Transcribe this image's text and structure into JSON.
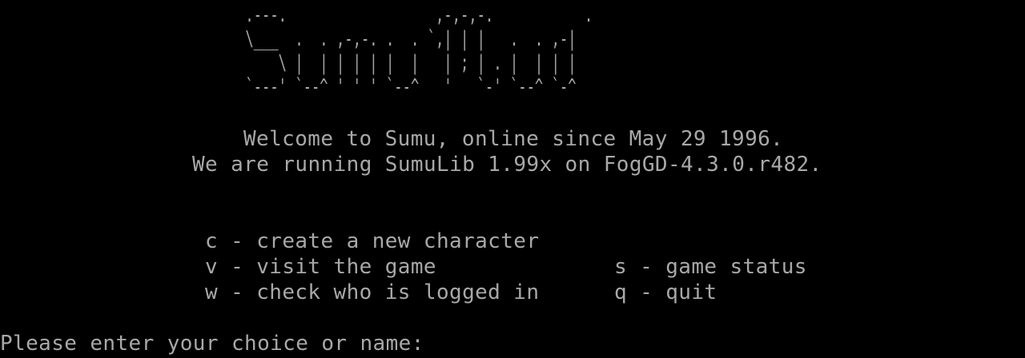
{
  "terminal": {
    "logo_ascii": " .---.                  ,-,-,-.           .\n \\___  .  . ,-,-. .  . `,| | |   .  . ,-|\n     \\ |  | | | | |  |   | ; | . |  | | |\n `---' `--^ ' ' ' `--^   '   `-' `--^ `-^",
    "welcome_line": "Welcome to Sumu, online since May 29 1996.",
    "running_line": "We are running SumuLib 1.99x on FogGD-4.3.0.r482.",
    "menu": {
      "create": "c - create a new character",
      "visit": "v - visit the game",
      "status": "s - game status",
      "who": "w - check who is logged in",
      "quit": "q - quit"
    },
    "prompt": "Please enter your choice or name:",
    "text_color": "#a8a8a8",
    "background_color": "#000000"
  }
}
